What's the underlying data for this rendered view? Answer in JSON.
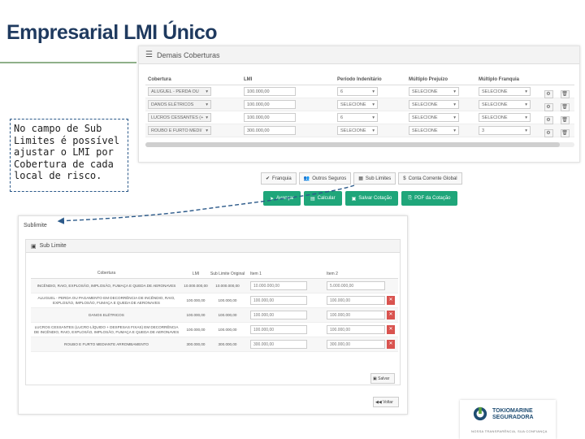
{
  "page": {
    "title": "Empresarial LMI Único"
  },
  "callout": {
    "text": "No campo de Sub Limites é possível ajustar o LMI por Cobertura de cada local de risco."
  },
  "coverages_panel": {
    "title": "Demais Coberturas",
    "headers": [
      "Cobertura",
      "LMI",
      "Período Indenitário",
      "Múltiplo Prejuízo",
      "Múltiplo Franquia"
    ],
    "rows": [
      {
        "cobertura": "ALUGUEL - PERDA OU",
        "lmi": "100.000,00",
        "periodo": "6",
        "multiplo_prejuizo": "SELECIONE",
        "multiplo_franquia": "SELECIONE"
      },
      {
        "cobertura": "DANOS ELÉTRICOS",
        "lmi": "100.000,00",
        "periodo": "SELECIONE",
        "multiplo_prejuizo": "SELECIONE",
        "multiplo_franquia": "SELECIONE"
      },
      {
        "cobertura": "LUCROS CESSANTES (+",
        "lmi": "100.000,00",
        "periodo": "6",
        "multiplo_prejuizo": "SELECIONE",
        "multiplo_franquia": "SELECIONE"
      },
      {
        "cobertura": "ROUBO E FURTO MEDI/",
        "lmi": "300.000,00",
        "periodo": "SELECIONE",
        "multiplo_prejuizo": "SELECIONE",
        "multiplo_franquia": "3"
      }
    ]
  },
  "tabs": [
    {
      "icon": "check-icon",
      "label": "Franquia"
    },
    {
      "icon": "users-icon",
      "label": "Outros Seguros"
    },
    {
      "icon": "grid-icon",
      "label": "Sub Limites"
    },
    {
      "icon": "dollar-icon",
      "label": "Conta Corrente Global"
    }
  ],
  "actions": [
    {
      "icon": "arrow-icon",
      "label": "Avançar"
    },
    {
      "icon": "calculator-icon",
      "label": "Calcular"
    },
    {
      "icon": "save-icon",
      "label": "Salvar Cotação"
    },
    {
      "icon": "pdf-icon",
      "label": "PDF da Cotação"
    }
  ],
  "sublimit": {
    "window_title": "Sublimite",
    "panel_title": "Sub Limite",
    "headers": {
      "cobertura": "Cobertura",
      "lmi": "LMI",
      "sub_limite": "Sub Limite Original",
      "item1": "Item 1",
      "item2": "Item 2"
    },
    "rows": [
      {
        "cobertura": "INCÊNDIO, RAIO, EXPLOSÃO, IMPLOSÃO, FUMAÇA E QUEDA DE AERONAVES",
        "lmi": "10.000.000,00",
        "original": "10.000.000,00",
        "item1": "10.000.000,00",
        "item2": "5.000.000,00",
        "removable": false
      },
      {
        "cobertura": "ALUGUEL - PERDA OU PAGAMENTO EM DECORRÊNCIA DE INCÊNDIO, RAIO, EXPLOSÃO, IMPLOSÃO, FUMAÇA E QUEDA DE AERONAVES",
        "lmi": "100.000,00",
        "original": "100.000,00",
        "item1": "100.000,00",
        "item2": "100.000,00",
        "removable": true
      },
      {
        "cobertura": "DANOS ELÉTRICOS",
        "lmi": "100.000,00",
        "original": "100.000,00",
        "item1": "100.000,00",
        "item2": "100.000,00",
        "removable": true
      },
      {
        "cobertura": "LUCROS CESSANTES (LUCRO LÍQUIDO + DESPESAS FIXAS) EM DECORRÊNCIA DE INCÊNDIO, RAIO, EXPLOSÃO, IMPLOSÃO, FUMAÇA E QUEDA DE AERONAVES",
        "lmi": "100.000,00",
        "original": "100.000,00",
        "item1": "100.000,00",
        "item2": "100.000,00",
        "removable": true
      },
      {
        "cobertura": "ROUBO E FURTO MEDIANTE ARROMBAMENTO",
        "lmi": "300.000,00",
        "original": "300.000,00",
        "item1": "300.000,00",
        "item2": "300.000,00",
        "removable": true
      }
    ],
    "save_label": "Salvar",
    "back_label": "Voltar"
  },
  "logo": {
    "line1": "TOKIOMARINE",
    "line2": "SEGURADORA",
    "tagline": "NOSSA TRANSPARÊNCIA, SUA CONFIANÇA",
    "color": "#1f4d73"
  },
  "colors": {
    "accent_green": "#1fa67a",
    "title_blue": "#1f3a5f",
    "remove_red": "#d9534f"
  }
}
